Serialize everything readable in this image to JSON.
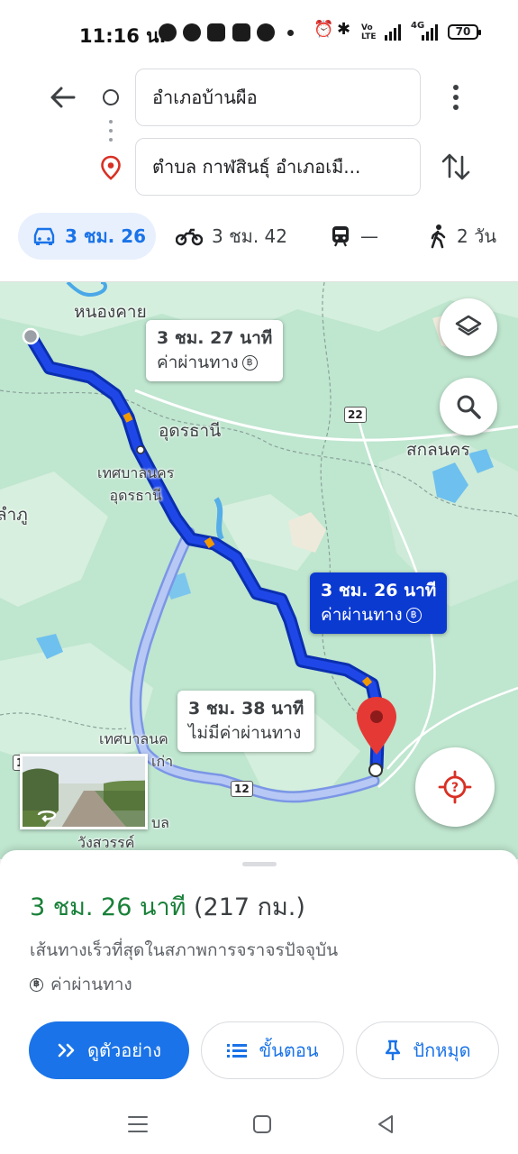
{
  "status_bar": {
    "time": "11:16 น.",
    "network": "4G",
    "volte": "Vo LTE",
    "battery": "70"
  },
  "directions": {
    "origin": "อำเภอบ้านผือ",
    "destination": "ตำบล กาฬสินธุ์ อำเภอเมื..."
  },
  "modes": [
    {
      "icon": "car-icon",
      "label": "3 ชม. 26",
      "active": true
    },
    {
      "icon": "motorcycle-icon",
      "label": "3 ชม. 42",
      "active": false
    },
    {
      "icon": "train-icon",
      "label": "—",
      "active": false
    },
    {
      "icon": "walk-icon",
      "label": "2 วัน",
      "active": false
    }
  ],
  "map": {
    "places": [
      {
        "name": "หนองคาย"
      },
      {
        "name": "อุดรธานี"
      },
      {
        "name": "เทศบาลนคร\nอุดรธานี"
      },
      {
        "name": "สกลนคร"
      },
      {
        "name": "ลำภู"
      },
      {
        "name": "เทศบาลนค"
      },
      {
        "name": "เก่า"
      },
      {
        "name": "บล"
      },
      {
        "name": "วังสวรรค์"
      }
    ],
    "road_shields": [
      "22",
      "12",
      "1"
    ],
    "route_callouts": [
      {
        "duration": "3 ชม. 27 นาที",
        "note": "ค่าผ่านทาง",
        "selected": false
      },
      {
        "duration": "3 ชม. 26 นาที",
        "note": "ค่าผ่านทาง",
        "selected": true
      },
      {
        "duration": "3 ชม. 38 นาที",
        "note": "ไม่มีค่าผ่านทาง",
        "selected": false
      }
    ],
    "route_color": "#0b3ad1",
    "alt_route_color": "#b7c8f5",
    "land_color": "#bfe6cf"
  },
  "summary": {
    "duration": "3 ชม. 26 นาที",
    "distance": "(217 กม.)",
    "description": "เส้นทางเร็วที่สุดในสภาพการจราจรปัจจุบัน",
    "toll_note": "ค่าผ่านทาง"
  },
  "actions": {
    "preview": "ดูตัวอย่าง",
    "steps": "ขั้นตอน",
    "pin": "ปักหมุด"
  },
  "colors": {
    "accent": "#1a73e8",
    "duration_green": "#188038"
  }
}
